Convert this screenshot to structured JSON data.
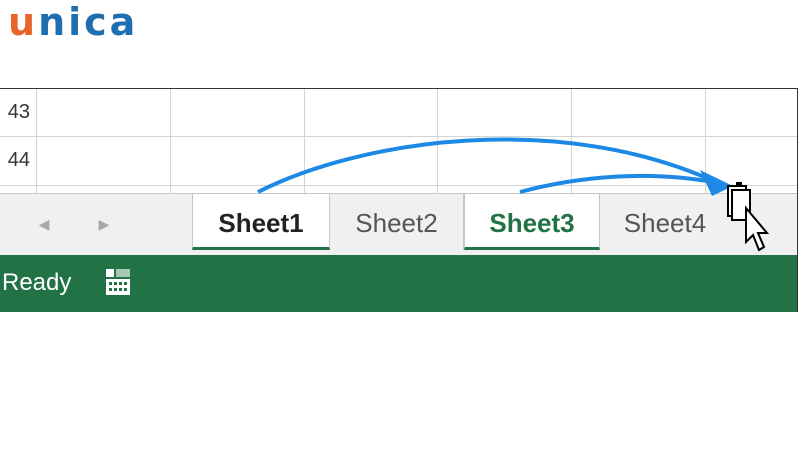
{
  "logo": {
    "first": "u",
    "rest": "nica"
  },
  "grid": {
    "rows": [
      "43",
      "44"
    ]
  },
  "tabs": [
    {
      "label": "Sheet1",
      "state": "active"
    },
    {
      "label": "Sheet2",
      "state": "normal"
    },
    {
      "label": "Sheet3",
      "state": "active-green"
    },
    {
      "label": "Sheet4",
      "state": "normal"
    }
  ],
  "nav": {
    "prev_icon": "triangle-left-icon",
    "next_icon": "triangle-right-icon"
  },
  "status": {
    "text": "Ready",
    "icon": "page-layout-icon"
  },
  "colors": {
    "excel_green": "#217346",
    "arrow_blue": "#1e88e5",
    "logo_orange": "#e8642c",
    "logo_blue": "#1f6fb0"
  }
}
